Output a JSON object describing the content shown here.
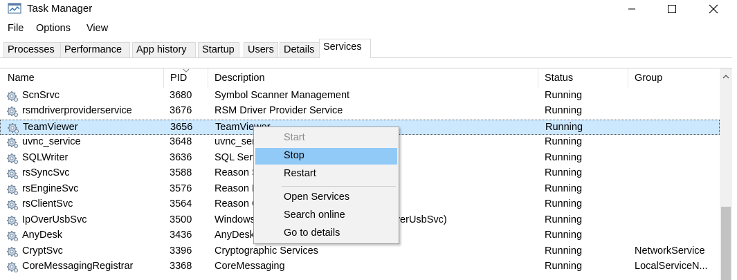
{
  "window": {
    "title": "Task Manager"
  },
  "menu": [
    "File",
    "Options",
    "View"
  ],
  "tabs": [
    "Processes",
    "Performance",
    "App history",
    "Startup",
    "Users",
    "Details",
    "Services"
  ],
  "active_tab": "Services",
  "columns": {
    "name": "Name",
    "pid": "PID",
    "description": "Description",
    "status": "Status",
    "group": "Group"
  },
  "rows": [
    {
      "name": "ScnSrvc",
      "pid": "3680",
      "description": "Symbol Scanner Management",
      "status": "Running",
      "group": ""
    },
    {
      "name": "rsmdriverproviderservice",
      "pid": "3676",
      "description": "RSM Driver Provider Service",
      "status": "Running",
      "group": ""
    },
    {
      "name": "TeamViewer",
      "pid": "3656",
      "description": "TeamViewer",
      "status": "Running",
      "group": "",
      "selected": true
    },
    {
      "name": "uvnc_service",
      "pid": "3648",
      "description": "uvnc_service",
      "status": "Running",
      "group": ""
    },
    {
      "name": "SQLWriter",
      "pid": "3636",
      "description": "SQL Server VSS Writer",
      "status": "Running",
      "group": ""
    },
    {
      "name": "rsSyncSvc",
      "pid": "3588",
      "description": "Reason Sync Service",
      "status": "Running",
      "group": ""
    },
    {
      "name": "rsEngineSvc",
      "pid": "3576",
      "description": "Reason Engine Service",
      "status": "Running",
      "group": ""
    },
    {
      "name": "rsClientSvc",
      "pid": "3564",
      "description": "Reason Client Service",
      "status": "Running",
      "group": ""
    },
    {
      "name": "IpOverUsbSvc",
      "pid": "3500",
      "description": "Windows IP Over USB Port Service (IpOverUsbSvc)",
      "status": "Running",
      "group": ""
    },
    {
      "name": "AnyDesk",
      "pid": "3436",
      "description": "AnyDesk Service",
      "status": "Running",
      "group": ""
    },
    {
      "name": "CryptSvc",
      "pid": "3396",
      "description": "Cryptographic Services",
      "status": "Running",
      "group": "NetworkService"
    },
    {
      "name": "CoreMessagingRegistrar",
      "pid": "3368",
      "description": "CoreMessaging",
      "status": "Running",
      "group": "LocalServiceN..."
    }
  ],
  "context_menu": {
    "start": "Start",
    "stop": "Stop",
    "restart": "Restart",
    "open_services": "Open Services",
    "search_online": "Search online",
    "go_to_details": "Go to details"
  }
}
